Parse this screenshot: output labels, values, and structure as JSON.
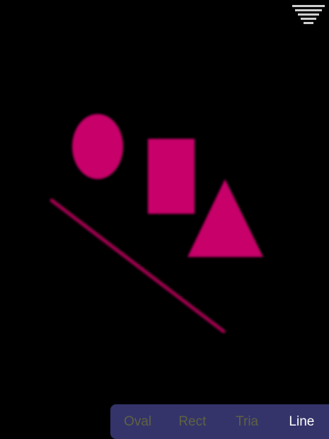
{
  "colors": {
    "background": "#000000",
    "shape_fill": "#c8006a",
    "line_stroke": "#a3004f",
    "tab_bar_bg": "#34346a",
    "tab_inactive": "#5f6142",
    "tab_active": "#ffffff",
    "menu_icon": "#cfcfcf"
  },
  "menu": {
    "icon": "hamburger-stack-icon"
  },
  "canvas": {
    "shapes": [
      "oval",
      "rectangle",
      "triangle",
      "line"
    ]
  },
  "tabs": [
    {
      "label": "Oval",
      "active": false
    },
    {
      "label": "Rect",
      "active": false
    },
    {
      "label": "Tria",
      "active": false
    },
    {
      "label": "Line",
      "active": true
    }
  ]
}
